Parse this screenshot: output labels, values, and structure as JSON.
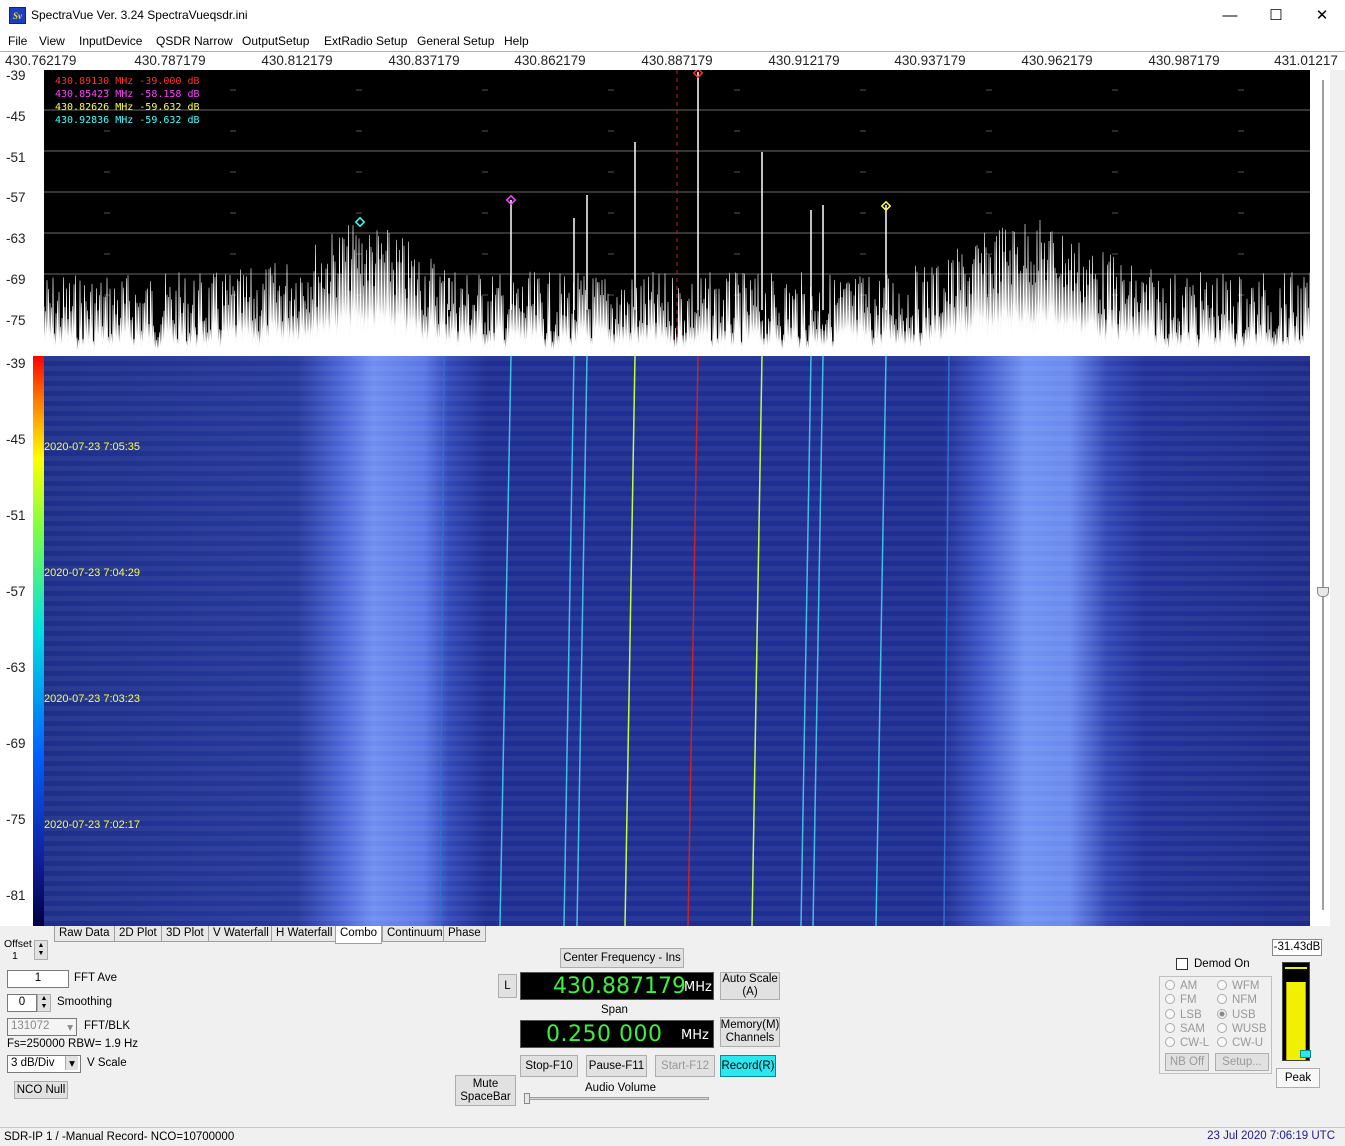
{
  "window": {
    "title": "SpectraVue Ver. 3.24  SpectraVueqsdr.ini",
    "icon_text": "Sv",
    "controls": {
      "minimize": "—",
      "maximize": "☐",
      "close": "✕"
    }
  },
  "menu": [
    "File",
    "View",
    "InputDevice",
    "QSDR Narrow",
    "OutputSetup",
    "ExtRadio Setup",
    "General Setup",
    "Help"
  ],
  "freq_axis": [
    "430.762179",
    "430.787179",
    "430.812179",
    "430.837179",
    "430.862179",
    "430.887179",
    "430.912179",
    "430.937179",
    "430.962179",
    "430.987179",
    "431.01217"
  ],
  "spectrum": {
    "y_ticks": [
      "-39",
      "-45",
      "-51",
      "-57",
      "-63",
      "-69",
      "-75"
    ],
    "markers": [
      {
        "text": "430.89130 MHz  -39.000  dB",
        "color": "#ff3030"
      },
      {
        "text": "430.85423 MHz  -58.158  dB",
        "color": "#ff40ff"
      },
      {
        "text": "430.82626 MHz  -59.632  dB",
        "color": "#ffff40"
      },
      {
        "text": "430.92836 MHz  -59.632  dB",
        "color": "#40ffff"
      }
    ]
  },
  "waterfall": {
    "y_ticks": [
      "-39",
      "-45",
      "-51",
      "-57",
      "-63",
      "-69",
      "-75",
      "-81"
    ],
    "timestamps": [
      "2020-07-23 7:05:35",
      "2020-07-23 7:04:29",
      "2020-07-23 7:03:23",
      "2020-07-23 7:02:17"
    ]
  },
  "tabs": [
    "Raw Data",
    "2D Plot",
    "3D Plot",
    "V Waterfall",
    "H Waterfall",
    "Combo",
    "Continuum",
    "Phase"
  ],
  "active_tab": "Combo",
  "left_controls": {
    "offset_label": "Offset",
    "offset_value": "1",
    "fft_ave_value": "1",
    "fft_ave_label": "FFT Ave",
    "smoothing_value": "0",
    "smoothing_label": "Smoothing",
    "fft_blk_value": "131072",
    "fft_blk_label": "FFT/BLK",
    "fs_rbw": "Fs=250000 RBW= 1.9 Hz",
    "vscale_value": "3 dB/Div",
    "vscale_label": "V Scale",
    "nco_null": "NCO Null"
  },
  "center": {
    "center_freq_button": "Center Frequency - Ins",
    "l_button": "L",
    "freq_value": "430.887179",
    "freq_unit": "MHz",
    "auto_scale": "Auto Scale (A)",
    "span_label": "Span",
    "span_value": "0.250 000",
    "span_unit": "MHz",
    "memory": "Memory(M) Channels",
    "stop": "Stop-F10",
    "pause": "Pause-F11",
    "start": "Start-F12",
    "record": "Record(R)",
    "mute": "Mute SpaceBar",
    "audio_volume": "Audio Volume"
  },
  "demod": {
    "demod_on": "Demod On",
    "modes_left": [
      "AM",
      "FM",
      "LSB",
      "SAM",
      "CW-L"
    ],
    "modes_right": [
      "WFM",
      "NFM",
      "USB",
      "WUSB",
      "CW-U"
    ],
    "selected": "USB",
    "nb_off": "NB Off",
    "setup": "Setup..."
  },
  "meter": {
    "level": "-31.43dB",
    "fill_fraction": 0.8,
    "peak": "Peak"
  },
  "status": {
    "left": "SDR-IP 1  /  -Manual Record-    NCO=10700000",
    "time": "23 Jul 2020  7:06:19 UTC"
  }
}
